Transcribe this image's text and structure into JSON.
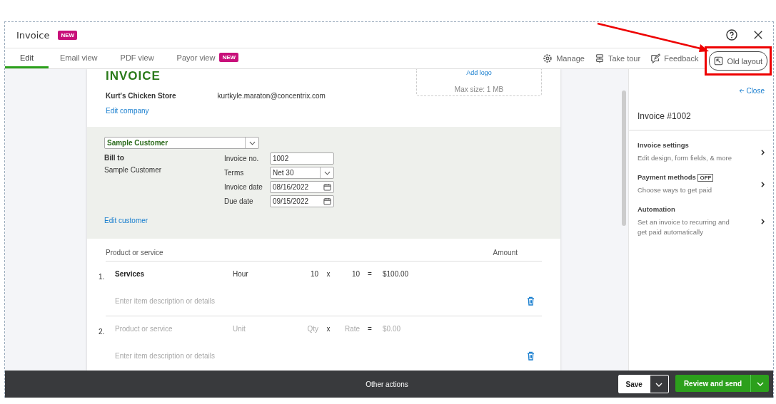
{
  "window": {
    "title": "Invoice",
    "badge": "NEW"
  },
  "tabs": [
    {
      "label": "Edit",
      "selected": true
    },
    {
      "label": "Email view",
      "selected": false
    },
    {
      "label": "PDF view",
      "selected": false
    },
    {
      "label": "Payor view",
      "selected": false,
      "badge": "NEW"
    }
  ],
  "toolbar": [
    {
      "kind": "gear",
      "label": "Manage"
    },
    {
      "kind": "tour",
      "label": "Take tour"
    },
    {
      "kind": "feedback",
      "label": "Feedback"
    },
    {
      "kind": "layout",
      "label": "Old layout"
    }
  ],
  "invoice": {
    "heading": "INVOICE",
    "company": "Kurt's Chicken Store",
    "email": "kurtkyle.maraton@concentrix.com",
    "edit_company": "Edit company",
    "logo_link": "Add logo",
    "logo_hint": "Max size: 1 MB",
    "customer": "Sample Customer",
    "bill_to_label": "Bill to",
    "bill_to": "Sample Customer",
    "edit_customer": "Edit customer",
    "fields": [
      {
        "kind": "text",
        "label": "Invoice no.",
        "value": "1002"
      },
      {
        "kind": "select",
        "label": "Terms",
        "value": "Net 30"
      },
      {
        "kind": "date",
        "label": "Invoice date",
        "value": "08/16/2022"
      },
      {
        "kind": "date",
        "label": "Due date",
        "value": "09/15/2022"
      }
    ],
    "columns": [
      "Product or service",
      "Amount"
    ],
    "lines": [
      {
        "number": "1.",
        "filled": true,
        "product": "Services",
        "unit": "Hour",
        "qty": "10",
        "times": "x",
        "rate": "10",
        "equals": "=",
        "amount": "$100.00",
        "description": "Enter item description or details"
      },
      {
        "number": "2.",
        "filled": false,
        "product": "Product or service",
        "unit": "Unit",
        "qty": "Qty",
        "times": "x",
        "rate": "Rate",
        "equals": "=",
        "amount": "$0.00",
        "description": "Enter item description or details"
      }
    ]
  },
  "panel": {
    "close": "Close",
    "title": "Invoice #1002",
    "items": [
      {
        "title": "Invoice settings",
        "subtitle": "Edit design, form fields, & more"
      },
      {
        "title": "Payment methods",
        "tag": "OFF",
        "subtitle": "Choose ways to get paid"
      },
      {
        "title": "Automation",
        "subtitle": "Set an invoice to recurring and get paid automatically"
      }
    ]
  },
  "footer": {
    "center": "Other actions",
    "save": "Save",
    "primary": "Review and send"
  }
}
